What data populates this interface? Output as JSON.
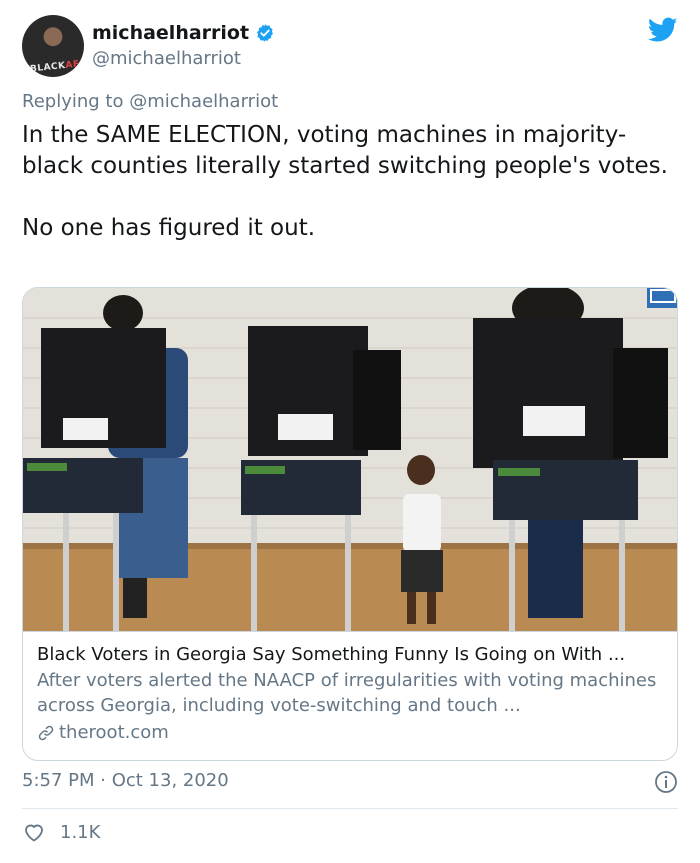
{
  "author": {
    "display_name": "michaelharriot",
    "handle": "@michaelharriot",
    "avatar_badge": "BLACK",
    "avatar_badge_suffix": "AF",
    "verified": true
  },
  "reply": {
    "prefix": "Replying to ",
    "mention": "@michaelharriot"
  },
  "tweet": {
    "text": "In the SAME ELECTION, voting machines in majority-black counties literally started switching people's votes.\n\nNo one has figured it out."
  },
  "card": {
    "title": "Black Voters in Georgia Say Something Funny Is Going on With ...",
    "description": "After voters alerted the NAACP of irregularities with voting machines across Georgia, including vote-switching and touch ...",
    "domain": "theroot.com"
  },
  "meta": {
    "time": "5:57 PM",
    "separator": " · ",
    "date": "Oct 13, 2020"
  },
  "engagement": {
    "likes": "1.1K"
  },
  "icons": {
    "brand": "twitter-bird-icon",
    "verified": "verified-badge-icon",
    "link": "link-icon",
    "info": "info-icon",
    "like": "heart-icon"
  },
  "colors": {
    "twitter_blue": "#1da1f2",
    "secondary_text": "#657786",
    "border": "#ccd6dd"
  }
}
